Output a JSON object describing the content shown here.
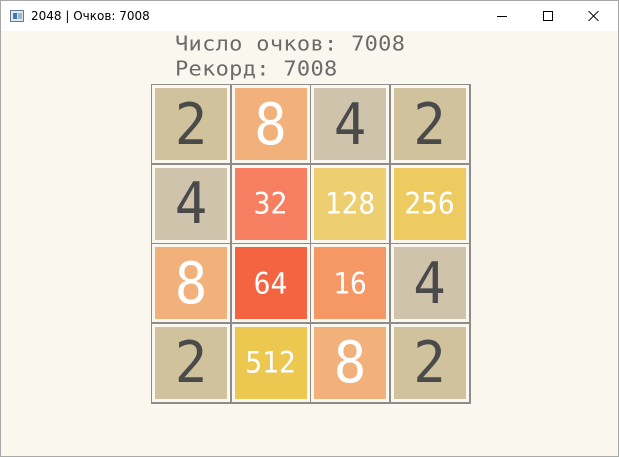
{
  "window": {
    "title": "2048 | Очков: 7008"
  },
  "header": {
    "score_text": "Число очков: 7008",
    "record_text": "Рекорд: 7008"
  },
  "board": {
    "rows": [
      [
        2,
        8,
        4,
        2
      ],
      [
        4,
        32,
        128,
        256
      ],
      [
        8,
        64,
        16,
        4
      ],
      [
        2,
        512,
        8,
        2
      ]
    ]
  },
  "tile_colors": {
    "2": {
      "bg": "#cfc29c",
      "fg": "#4a4a4a"
    },
    "4": {
      "bg": "#cfc3ab",
      "fg": "#4a4a4a"
    },
    "8": {
      "bg": "#f2b07a",
      "fg": "#ffffff"
    },
    "16": {
      "bg": "#f59866",
      "fg": "#ffffff"
    },
    "32": {
      "bg": "#f67f62",
      "fg": "#ffffff"
    },
    "64": {
      "bg": "#f56440",
      "fg": "#ffffff"
    },
    "128": {
      "bg": "#edcf72",
      "fg": "#ffffff"
    },
    "256": {
      "bg": "#edcb60",
      "fg": "#ffffff"
    },
    "512": {
      "bg": "#edc850",
      "fg": "#ffffff"
    }
  }
}
